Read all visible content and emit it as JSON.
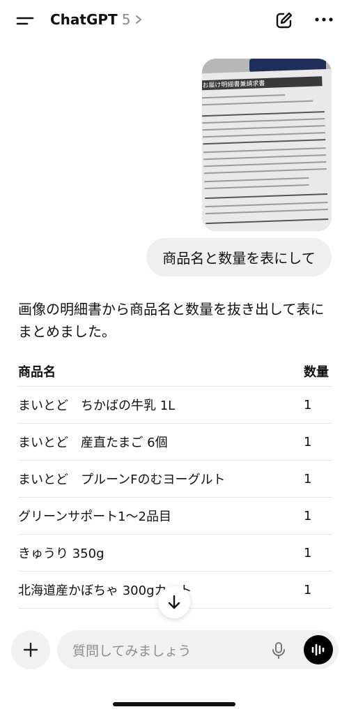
{
  "header": {
    "title": "ChatGPT",
    "model": "5",
    "icons": [
      "menu-icon",
      "chevron-right-icon",
      "edit-icon",
      "more-icon"
    ]
  },
  "attachment": {
    "doc_header_text": "お届け明細書兼請求書"
  },
  "user_message": "商品名と数量を表にして",
  "assistant": {
    "text": "画像の明細書から商品名と数量を抜き出して表にまとめました。",
    "table": {
      "headers": [
        "商品名",
        "数量"
      ],
      "rows": [
        {
          "name": "まいとど　ちかばの牛乳 1L",
          "qty": "1"
        },
        {
          "name": "まいとど　産直たまご 6個",
          "qty": "1"
        },
        {
          "name": "まいとど　プルーンFのむヨーグルト",
          "qty": "1"
        },
        {
          "name": "グリーンサポート1〜2品目",
          "qty": "1"
        },
        {
          "name": "きゅうり 350g",
          "qty": "1"
        },
        {
          "name": "北海道産かぼちゃ 300gカット",
          "qty": "1"
        }
      ]
    }
  },
  "composer": {
    "placeholder": "質問してみましょう"
  },
  "colors": {
    "bubble_bg": "#efefef",
    "composer_bg": "#f1f1f1",
    "voice_button": "#000000"
  }
}
